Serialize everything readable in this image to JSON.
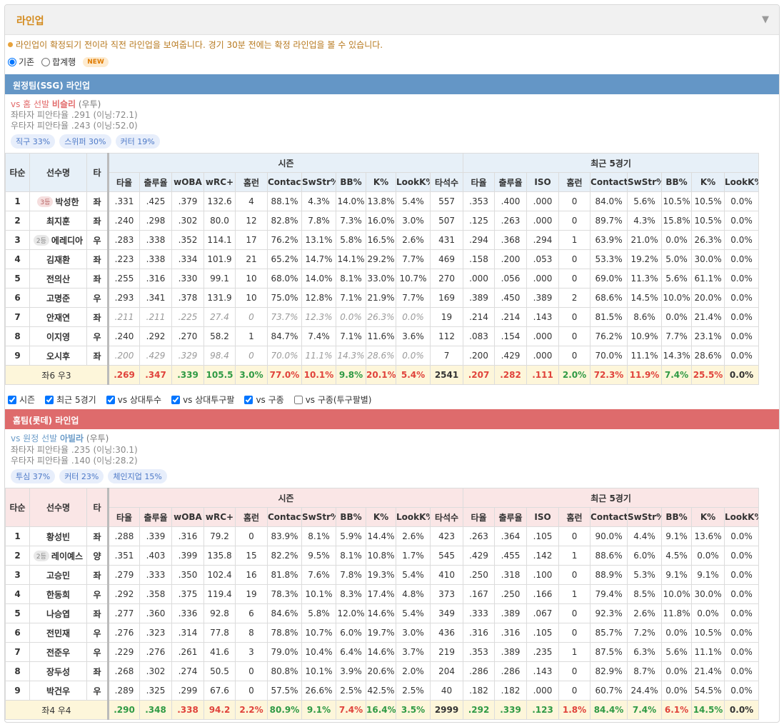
{
  "panel": {
    "title": "라인업",
    "collapse_icon": "▼"
  },
  "notice": "라인업이 확정되기 전이라 직전 라인업을 보여줍니다. 경기 30분 전에는 확정 라인업을 볼 수 있습니다.",
  "view_options": {
    "basic": "기존",
    "combined": "합계행",
    "new_badge": "NEW"
  },
  "headers": {
    "order": "타순",
    "name": "선수명",
    "hand": "타",
    "season": "시즌",
    "recent": "최근 5경기",
    "season_cols": [
      "타율",
      "출루율",
      "wOBA",
      "wRC+",
      "홈런",
      "Contact%",
      "SwStr%",
      "BB%",
      "K%",
      "LookK%",
      "타석수"
    ],
    "recent_cols": [
      "타율",
      "출루율",
      "ISO",
      "홈런",
      "Contact%",
      "SwStr%",
      "BB%",
      "K%",
      "LookK%"
    ]
  },
  "away": {
    "bar": "원정팀(SSG) 라인업",
    "starter": {
      "prefix": "vs 홈 선발 ",
      "name": "비슬리",
      "hand": "(우투)"
    },
    "split_left": "좌타자 피안타율 .291 (이닝:72.1)",
    "split_right": "우타자 피안타율 .243 (이닝:52.0)",
    "tags": [
      "직구 33%",
      "스위퍼 30%",
      "커터 19%"
    ],
    "rows": [
      {
        "o": "1",
        "rank": "3등",
        "n": "박성한",
        "h": "좌",
        "s": [
          ".331",
          ".425",
          ".379",
          "132.6",
          "4",
          "88.1%",
          "4.3%",
          "14.0%",
          "13.8%",
          "5.4%",
          "557"
        ],
        "r": [
          ".353",
          ".400",
          ".000",
          "0",
          "84.0%",
          "5.6%",
          "10.5%",
          "10.5%",
          "0.0%"
        ]
      },
      {
        "o": "2",
        "rank": "",
        "n": "최지훈",
        "h": "좌",
        "s": [
          ".240",
          ".298",
          ".302",
          "80.0",
          "12",
          "82.8%",
          "7.8%",
          "7.3%",
          "16.0%",
          "3.0%",
          "507"
        ],
        "r": [
          ".125",
          ".263",
          ".000",
          "0",
          "89.7%",
          "4.3%",
          "15.8%",
          "10.5%",
          "0.0%"
        ]
      },
      {
        "o": "3",
        "rank": "2등",
        "n": "에레디아",
        "h": "우",
        "s": [
          ".283",
          ".338",
          ".352",
          "114.1",
          "17",
          "76.2%",
          "13.1%",
          "5.8%",
          "16.5%",
          "2.6%",
          "431"
        ],
        "r": [
          ".294",
          ".368",
          ".294",
          "1",
          "63.9%",
          "21.0%",
          "0.0%",
          "26.3%",
          "0.0%"
        ]
      },
      {
        "o": "4",
        "rank": "",
        "n": "김재환",
        "h": "좌",
        "s": [
          ".223",
          ".338",
          ".334",
          "101.9",
          "21",
          "65.2%",
          "14.7%",
          "14.1%",
          "29.2%",
          "7.7%",
          "469"
        ],
        "r": [
          ".158",
          ".200",
          ".053",
          "0",
          "53.3%",
          "19.2%",
          "5.0%",
          "30.0%",
          "0.0%"
        ]
      },
      {
        "o": "5",
        "rank": "",
        "n": "전의산",
        "h": "좌",
        "s": [
          ".255",
          ".316",
          ".330",
          "99.1",
          "10",
          "68.0%",
          "14.0%",
          "8.1%",
          "33.0%",
          "10.7%",
          "270"
        ],
        "r": [
          ".000",
          ".056",
          ".000",
          "0",
          "69.0%",
          "11.3%",
          "5.6%",
          "61.1%",
          "0.0%"
        ]
      },
      {
        "o": "6",
        "rank": "",
        "n": "고명준",
        "h": "우",
        "s": [
          ".293",
          ".341",
          ".378",
          "131.9",
          "10",
          "75.0%",
          "12.8%",
          "7.1%",
          "21.9%",
          "7.7%",
          "169"
        ],
        "r": [
          ".389",
          ".450",
          ".389",
          "2",
          "68.6%",
          "14.5%",
          "10.0%",
          "20.0%",
          "0.0%"
        ]
      },
      {
        "o": "7",
        "rank": "",
        "n": "안재연",
        "h": "좌",
        "dim": true,
        "s": [
          ".211",
          ".211",
          ".225",
          "27.4",
          "0",
          "73.7%",
          "12.3%",
          "0.0%",
          "26.3%",
          "0.0%",
          "19"
        ],
        "r": [
          ".214",
          ".214",
          ".143",
          "0",
          "81.5%",
          "8.6%",
          "0.0%",
          "21.4%",
          "0.0%"
        ]
      },
      {
        "o": "8",
        "rank": "",
        "n": "이지영",
        "h": "우",
        "s": [
          ".240",
          ".292",
          ".270",
          "58.2",
          "1",
          "84.7%",
          "7.4%",
          "7.1%",
          "11.6%",
          "3.6%",
          "112"
        ],
        "r": [
          ".083",
          ".154",
          ".000",
          "0",
          "76.2%",
          "10.9%",
          "7.7%",
          "23.1%",
          "0.0%"
        ]
      },
      {
        "o": "9",
        "rank": "",
        "n": "오시후",
        "h": "좌",
        "dim": true,
        "s": [
          ".200",
          ".429",
          ".329",
          "98.4",
          "0",
          "70.0%",
          "11.1%",
          "14.3%",
          "28.6%",
          "0.0%",
          "7"
        ],
        "r": [
          ".200",
          ".429",
          ".000",
          "0",
          "70.0%",
          "11.1%",
          "14.3%",
          "28.6%",
          "0.0%"
        ]
      }
    ],
    "total": {
      "label": "좌6 우3",
      "s": [
        ".269",
        ".347",
        ".339",
        "105.5",
        "3.0%",
        "77.0%",
        "10.1%",
        "9.8%",
        "20.1%",
        "5.4%",
        "2541"
      ],
      "r": [
        ".207",
        ".282",
        ".111",
        "2.0%",
        "72.3%",
        "11.9%",
        "7.4%",
        "25.5%",
        "0.0%"
      ]
    },
    "total_colors": {
      "s": [
        "r",
        "r",
        "g",
        "g",
        "g",
        "r",
        "r",
        "g",
        "r",
        "r",
        ""
      ],
      "r": [
        "r",
        "r",
        "r",
        "g",
        "r",
        "r",
        "g",
        "r",
        ""
      ]
    }
  },
  "filters": [
    "시즌",
    "최근 5경기",
    "vs 상대투수",
    "vs 상대투구팔",
    "vs 구종",
    "vs 구종(투구팔별)"
  ],
  "home": {
    "bar": "홈팀(롯데) 라인업",
    "starter": {
      "prefix": "vs 원정 선발 ",
      "name": "아빌라",
      "hand": "(우투)"
    },
    "split_left": "좌타자 피안타율 .235 (이닝:30.1)",
    "split_right": "우타자 피안타율 .140 (이닝:28.2)",
    "tags": [
      "투심 37%",
      "커터 23%",
      "체인지업 15%"
    ],
    "rows": [
      {
        "o": "1",
        "rank": "",
        "n": "황성빈",
        "h": "좌",
        "s": [
          ".288",
          ".339",
          ".316",
          "79.2",
          "0",
          "83.9%",
          "8.1%",
          "5.9%",
          "14.4%",
          "2.6%",
          "423"
        ],
        "r": [
          ".263",
          ".364",
          ".105",
          "0",
          "90.0%",
          "4.4%",
          "9.1%",
          "13.6%",
          "0.0%"
        ]
      },
      {
        "o": "2",
        "rank": "2등",
        "n": "레이예스",
        "h": "양",
        "s": [
          ".351",
          ".403",
          ".399",
          "135.8",
          "15",
          "82.2%",
          "9.5%",
          "8.1%",
          "10.8%",
          "1.7%",
          "545"
        ],
        "r": [
          ".429",
          ".455",
          ".142",
          "1",
          "88.6%",
          "6.0%",
          "4.5%",
          "0.0%",
          "0.0%"
        ]
      },
      {
        "o": "3",
        "rank": "",
        "n": "고승민",
        "h": "좌",
        "s": [
          ".279",
          ".333",
          ".350",
          "102.4",
          "16",
          "81.8%",
          "7.6%",
          "7.8%",
          "19.3%",
          "5.4%",
          "410"
        ],
        "r": [
          ".250",
          ".318",
          ".100",
          "0",
          "88.9%",
          "5.3%",
          "9.1%",
          "9.1%",
          "0.0%"
        ]
      },
      {
        "o": "4",
        "rank": "",
        "n": "한동희",
        "h": "우",
        "s": [
          ".292",
          ".358",
          ".375",
          "119.4",
          "19",
          "78.3%",
          "10.1%",
          "8.3%",
          "17.4%",
          "4.8%",
          "373"
        ],
        "r": [
          ".167",
          ".250",
          ".166",
          "1",
          "79.4%",
          "8.5%",
          "10.0%",
          "30.0%",
          "0.0%"
        ]
      },
      {
        "o": "5",
        "rank": "",
        "n": "나승엽",
        "h": "좌",
        "s": [
          ".277",
          ".360",
          ".336",
          "92.8",
          "6",
          "84.6%",
          "5.8%",
          "12.0%",
          "14.6%",
          "5.4%",
          "349"
        ],
        "r": [
          ".333",
          ".389",
          ".067",
          "0",
          "92.3%",
          "2.6%",
          "11.8%",
          "0.0%",
          "0.0%"
        ]
      },
      {
        "o": "6",
        "rank": "",
        "n": "전민재",
        "h": "우",
        "s": [
          ".276",
          ".323",
          ".314",
          "77.8",
          "8",
          "78.8%",
          "10.7%",
          "6.0%",
          "19.7%",
          "3.0%",
          "436"
        ],
        "r": [
          ".316",
          ".316",
          ".105",
          "0",
          "85.7%",
          "7.2%",
          "0.0%",
          "10.5%",
          "0.0%"
        ]
      },
      {
        "o": "7",
        "rank": "",
        "n": "전준우",
        "h": "우",
        "s": [
          ".229",
          ".276",
          ".261",
          "41.6",
          "3",
          "79.0%",
          "10.4%",
          "6.4%",
          "14.6%",
          "3.7%",
          "219"
        ],
        "r": [
          ".353",
          ".389",
          ".235",
          "1",
          "87.5%",
          "6.3%",
          "5.6%",
          "11.1%",
          "0.0%"
        ]
      },
      {
        "o": "8",
        "rank": "",
        "n": "장두성",
        "h": "좌",
        "s": [
          ".268",
          ".302",
          ".274",
          "50.5",
          "0",
          "80.8%",
          "10.1%",
          "3.9%",
          "20.6%",
          "2.0%",
          "204"
        ],
        "r": [
          ".286",
          ".286",
          ".143",
          "0",
          "82.9%",
          "8.7%",
          "0.0%",
          "21.4%",
          "0.0%"
        ]
      },
      {
        "o": "9",
        "rank": "",
        "n": "박건우",
        "h": "우",
        "s": [
          ".289",
          ".325",
          ".299",
          "67.6",
          "0",
          "57.5%",
          "26.6%",
          "2.5%",
          "42.5%",
          "2.5%",
          "40"
        ],
        "r": [
          ".182",
          ".182",
          ".000",
          "0",
          "60.7%",
          "24.4%",
          "0.0%",
          "54.5%",
          "0.0%"
        ]
      }
    ],
    "total": {
      "label": "좌4 우4",
      "s": [
        ".290",
        ".348",
        ".338",
        "94.2",
        "2.2%",
        "80.9%",
        "9.1%",
        "7.4%",
        "16.4%",
        "3.5%",
        "2999"
      ],
      "r": [
        ".292",
        ".339",
        ".123",
        "1.8%",
        "84.4%",
        "7.4%",
        "6.1%",
        "14.5%",
        "0.0%"
      ]
    },
    "total_colors": {
      "s": [
        "g",
        "g",
        "r",
        "r",
        "r",
        "g",
        "g",
        "r",
        "g",
        "g",
        ""
      ],
      "r": [
        "g",
        "g",
        "g",
        "r",
        "g",
        "g",
        "r",
        "g",
        ""
      ]
    }
  },
  "colors": {
    "away_bar": "#6496c6",
    "home_bar": "#de6b6c",
    "title": "#d48a1c",
    "good": "#2f9a44",
    "bad": "#e0433b"
  }
}
